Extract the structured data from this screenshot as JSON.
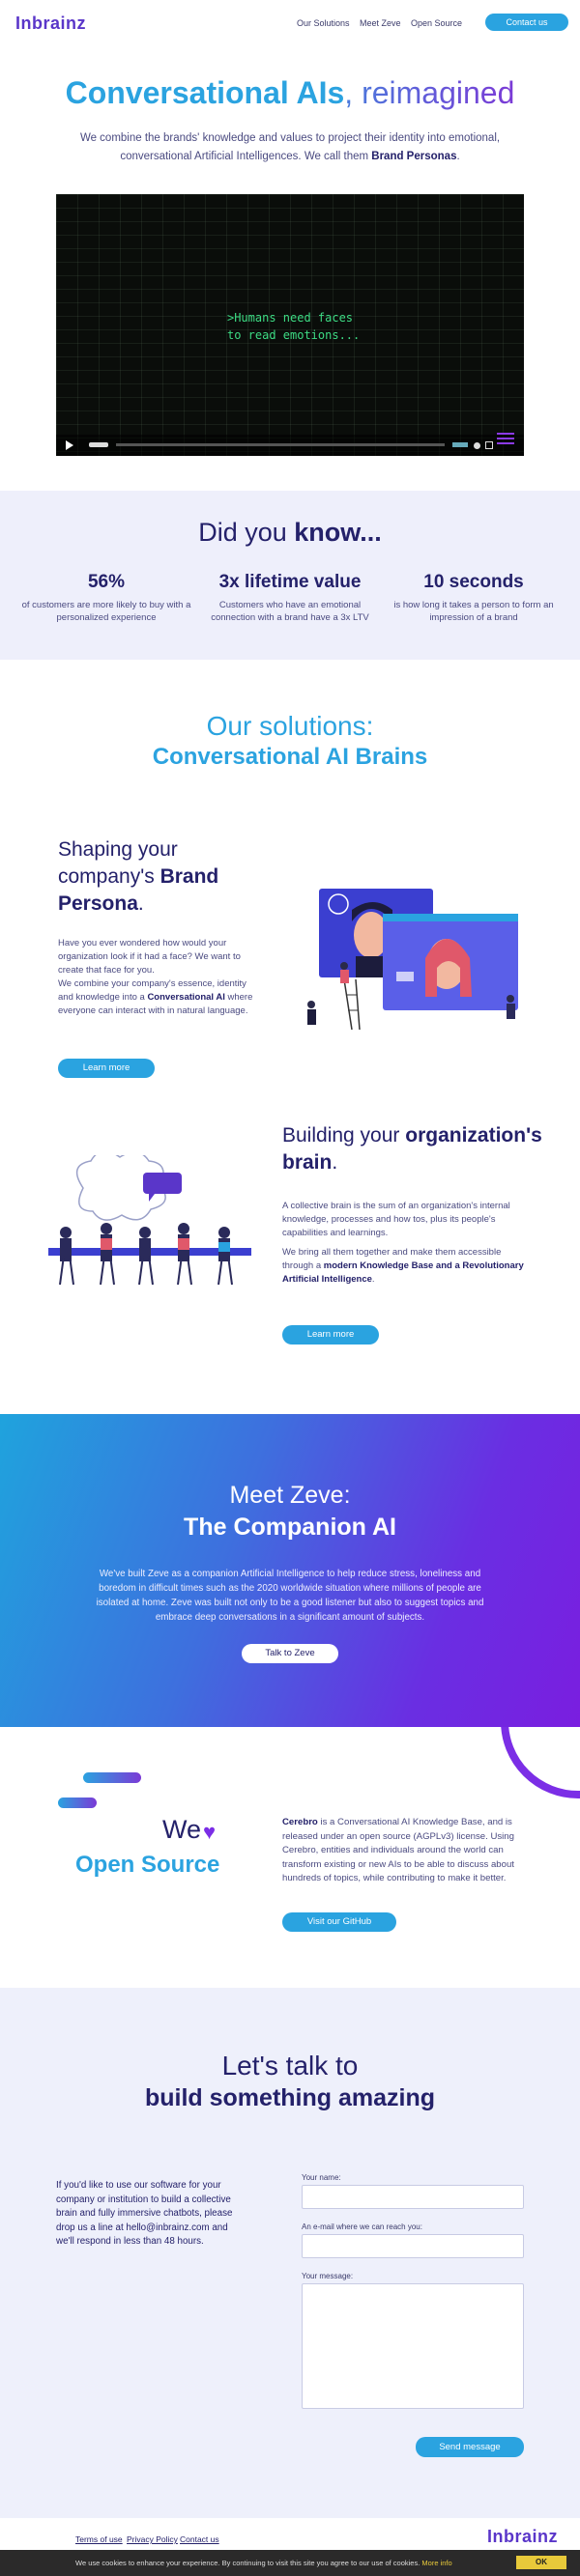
{
  "header": {
    "logo": "Inbrainz",
    "nav": [
      "Our Solutions",
      "Meet Zeve",
      "Open Source"
    ],
    "cta": "Contact us"
  },
  "hero": {
    "title_bold": "Conversational AIs",
    "title_rest": ", reimagined",
    "subtitle_pre": "We combine the brands' knowledge and values to project their identity into emotional, conversational Artificial Intelligences. We call them ",
    "subtitle_bold": "Brand Personas",
    "subtitle_post": ".",
    "video_text": ">Humans need faces\n to read emotions..."
  },
  "did_you_know": {
    "title_pre": "Did you ",
    "title_bold": "know...",
    "stats": [
      {
        "number": "56%",
        "desc": "of customers are more likely to buy with a personalized experience"
      },
      {
        "number": "3x lifetime value",
        "desc": "Customers who have an emotional connection with a brand have a 3x LTV"
      },
      {
        "number": "10 seconds",
        "desc": "is how long it takes a person to form an impression of a brand"
      }
    ]
  },
  "solutions": {
    "title1": "Our solutions:",
    "title2": "Conversational AI Brains",
    "brand": {
      "h_line1": "Shaping your",
      "h_line2_pre": "company's ",
      "h_line2_bold": "Brand",
      "h_line3_bold": "Persona",
      "h_line3_post": ".",
      "p1": "Have you ever wondered how would your organization look if it had a face? We want to create that face for you.",
      "p2_pre": "We combine your company's essence, identity and knowledge into a ",
      "p2_bold": "Conversational AI",
      "p2_post": " where everyone can interact with in natural language.",
      "button": "Learn more"
    },
    "brain": {
      "h_pre": "Building your ",
      "h_bold1": "organization's",
      "h_bold2": "brain",
      "h_post": ".",
      "p1": "A collective brain is the sum of an organization's internal knowledge, processes and how tos, plus its people's capabilities and learnings.",
      "p2_pre": "We bring all them together and make them accessible through a ",
      "p2_bold": "modern Knowledge Base and a Revolutionary Artificial Intelligence",
      "p2_post": ".",
      "button": "Learn more"
    }
  },
  "zeve": {
    "title1": "Meet Zeve:",
    "title2": "The Companion AI",
    "text": "We've built Zeve as a companion Artificial Intelligence to help reduce stress, loneliness and boredom in difficult times such as the 2020 worldwide situation where millions of people are isolated at home. Zeve was built not only to be a good listener but also to suggest topics and embrace deep conversations in a significant amount of subjects.",
    "button": "Talk to Zeve"
  },
  "open_source": {
    "we": "We",
    "heart": "♥",
    "title": "Open Source",
    "text_bold": "Cerebro",
    "text": " is a Conversational AI Knowledge Base, and is released under an open source (AGPLv3) license. Using Cerebro, entities and individuals around the world can transform existing or new AIs to be able to discuss about hundreds of topics, while contributing to make it better.",
    "button": "Visit our GitHub"
  },
  "contact": {
    "title1": "Let's talk to",
    "title2": "build something amazing",
    "text": "If you'd like to use our software for your company or institution to build a collective brain and fully immersive chatbots, please drop us a line at hello@inbrainz.com and we'll respond in less than 48 hours.",
    "label_name": "Your name:",
    "label_email": "An e-mail where we can reach you:",
    "label_message": "Your message:",
    "button": "Send message"
  },
  "footer": {
    "links": [
      "Terms of use",
      "Privacy Policy",
      "Contact us"
    ],
    "logo": "Inbrainz"
  },
  "cookie": {
    "text": "We use cookies to enhance your experience. By continuing to visit this site you agree to our use of cookies. ",
    "more": "More info",
    "button": "OK"
  },
  "colors": {
    "accent": "#2aa3e0",
    "navy": "#24216a",
    "purple": "#7b2ee6"
  }
}
